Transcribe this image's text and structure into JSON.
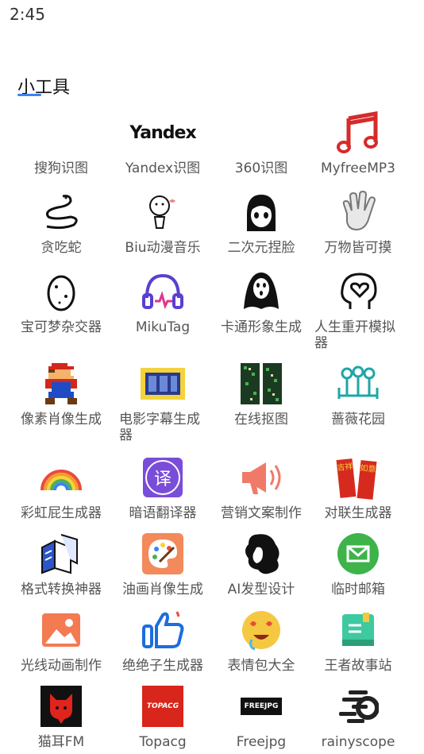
{
  "status_bar": {
    "time": "2:45"
  },
  "section": {
    "title": "小工具"
  },
  "tools": [
    {
      "label": "搜狗识图",
      "icon": "sogou-icon"
    },
    {
      "label": "Yandex识图",
      "icon": "yandex-logo",
      "logo_text": "Yandex"
    },
    {
      "label": "360识图",
      "icon": "blank-icon"
    },
    {
      "label": "MyfreeMP3",
      "icon": "music-note-icon"
    },
    {
      "label": "贪吃蛇",
      "icon": "snake-icon"
    },
    {
      "label": "Biu动漫音乐",
      "icon": "doodle-character-icon"
    },
    {
      "label": "二次元捏脸",
      "icon": "anime-face-icon"
    },
    {
      "label": "万物皆可摸",
      "icon": "hand-icon"
    },
    {
      "label": "宝可梦杂交器",
      "icon": "egg-icon"
    },
    {
      "label": "MikuTag",
      "icon": "headphones-icon"
    },
    {
      "label": "卡通形象生成",
      "icon": "ghost-icon"
    },
    {
      "label": "人生重开模拟器",
      "icon": "head-heart-icon"
    },
    {
      "label": "像素肖像生成",
      "icon": "pixel-character-icon"
    },
    {
      "label": "电影字幕生成器",
      "icon": "film-strip-icon"
    },
    {
      "label": "在线抠图",
      "icon": "film-grid-icon"
    },
    {
      "label": "蔷薇花园",
      "icon": "garden-icon"
    },
    {
      "label": "彩虹屁生成器",
      "icon": "rainbow-icon"
    },
    {
      "label": "暗语翻译器",
      "icon": "translate-icon",
      "logo_text": "译"
    },
    {
      "label": "营销文案制作",
      "icon": "megaphone-icon"
    },
    {
      "label": "对联生成器",
      "icon": "couplet-icon",
      "logo_text": [
        "吉祥",
        "如意"
      ]
    },
    {
      "label": "格式转换神器",
      "icon": "convert-icon"
    },
    {
      "label": "油画肖像生成",
      "icon": "palette-icon"
    },
    {
      "label": "AI发型设计",
      "icon": "hairstyle-icon"
    },
    {
      "label": "临时邮箱",
      "icon": "mail-icon"
    },
    {
      "label": "光线动画制作",
      "icon": "image-icon"
    },
    {
      "label": "绝绝子生成器",
      "icon": "thumbs-up-icon"
    },
    {
      "label": "表情包大全",
      "icon": "emoji-icon"
    },
    {
      "label": "王者故事站",
      "icon": "book-icon"
    },
    {
      "label": "猫耳FM",
      "icon": "cat-ear-icon"
    },
    {
      "label": "Topacg",
      "icon": "topacg-logo",
      "logo_text": "TOPACG"
    },
    {
      "label": "Freejpg",
      "icon": "freejpg-logo",
      "logo_text": "FREEJPG"
    },
    {
      "label": "rainyscope",
      "icon": "rainyscope-logo"
    }
  ]
}
